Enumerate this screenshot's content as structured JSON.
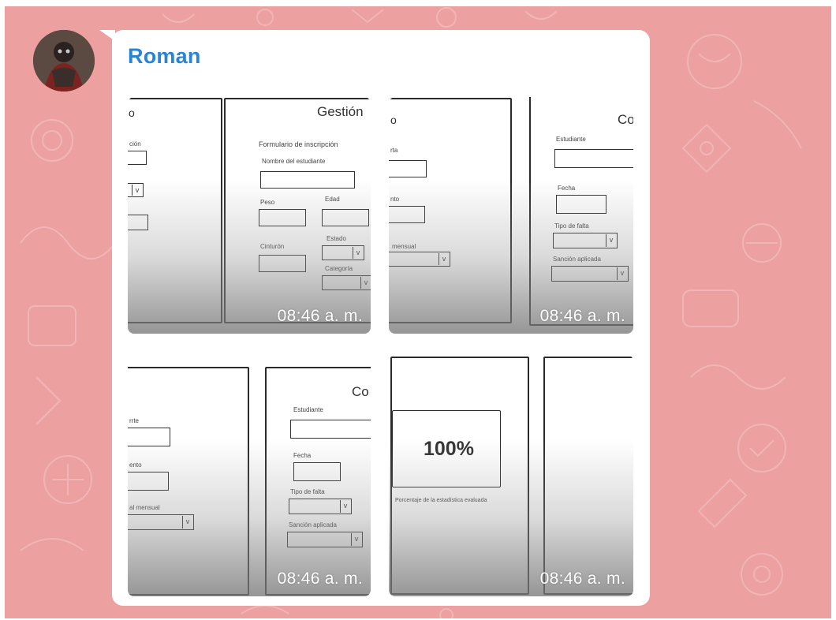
{
  "message": {
    "sender": "Roman",
    "timestamp": "08:46 a. m."
  },
  "tiles": [
    {
      "panel_title": "Gestión",
      "left_panel_title": "o",
      "left_labels": [
        "ción"
      ],
      "form_heading": "Formulario de inscripción",
      "labels": [
        "Nombre del estudiante",
        "Peso",
        "Edad",
        "Cinturón",
        "Estado",
        "Categoría"
      ]
    },
    {
      "panel_title": "Co",
      "left_panel_title": "o",
      "left_labels": [
        "rta",
        "nto",
        "mensual"
      ],
      "labels": [
        "Estudiante",
        "Fecha",
        "Tipo de falta",
        "Sanción aplicada"
      ]
    },
    {
      "panel_title": "Co",
      "left_labels": [
        "rrte",
        "ento",
        "al mensual"
      ],
      "labels": [
        "Estudiante",
        "Fecha",
        "Tipo de falta",
        "Sanción aplicada"
      ]
    },
    {
      "stat_value": "100%",
      "stat_caption": "Porcentaje de la estadística evaluada"
    }
  ]
}
